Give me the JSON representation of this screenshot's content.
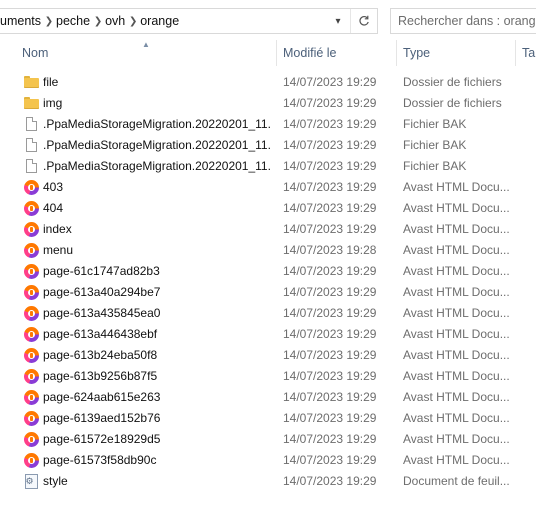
{
  "breadcrumb": [
    "uments",
    "peche",
    "ovh",
    "orange"
  ],
  "search": {
    "placeholder": "Rechercher dans : orange"
  },
  "columns": {
    "name": "Nom",
    "modified": "Modifié le",
    "type": "Type",
    "size": "Ta"
  },
  "icons": {
    "folder": "folder-icon",
    "file": "file-icon",
    "avast": "avast-html-icon",
    "stylesheet": "stylesheet-icon",
    "chevron": "chevron-right-icon",
    "refresh": "refresh-icon"
  },
  "colors": {
    "header_text": "#4c607a",
    "meta_text": "#6d6d6d",
    "folder": "#f4c44e"
  },
  "files": [
    {
      "name": "file",
      "date": "14/07/2023 19:29",
      "type": "Dossier de fichiers",
      "icon": "folder"
    },
    {
      "name": "img",
      "date": "14/07/2023 19:29",
      "type": "Dossier de fichiers",
      "icon": "folder"
    },
    {
      "name": ".PpaMediaStorageMigration.20220201_11...",
      "date": "14/07/2023 19:29",
      "type": "Fichier BAK",
      "icon": "file"
    },
    {
      "name": ".PpaMediaStorageMigration.20220201_11...",
      "date": "14/07/2023 19:29",
      "type": "Fichier BAK",
      "icon": "file"
    },
    {
      "name": ".PpaMediaStorageMigration.20220201_11...",
      "date": "14/07/2023 19:29",
      "type": "Fichier BAK",
      "icon": "file"
    },
    {
      "name": "403",
      "date": "14/07/2023 19:29",
      "type": "Avast HTML Docu...",
      "icon": "avast"
    },
    {
      "name": "404",
      "date": "14/07/2023 19:29",
      "type": "Avast HTML Docu...",
      "icon": "avast"
    },
    {
      "name": "index",
      "date": "14/07/2023 19:29",
      "type": "Avast HTML Docu...",
      "icon": "avast"
    },
    {
      "name": "menu",
      "date": "14/07/2023 19:28",
      "type": "Avast HTML Docu...",
      "icon": "avast"
    },
    {
      "name": "page-61c1747ad82b3",
      "date": "14/07/2023 19:29",
      "type": "Avast HTML Docu...",
      "icon": "avast"
    },
    {
      "name": "page-613a40a294be7",
      "date": "14/07/2023 19:29",
      "type": "Avast HTML Docu...",
      "icon": "avast"
    },
    {
      "name": "page-613a435845ea0",
      "date": "14/07/2023 19:29",
      "type": "Avast HTML Docu...",
      "icon": "avast"
    },
    {
      "name": "page-613a446438ebf",
      "date": "14/07/2023 19:29",
      "type": "Avast HTML Docu...",
      "icon": "avast"
    },
    {
      "name": "page-613b24eba50f8",
      "date": "14/07/2023 19:29",
      "type": "Avast HTML Docu...",
      "icon": "avast"
    },
    {
      "name": "page-613b9256b87f5",
      "date": "14/07/2023 19:29",
      "type": "Avast HTML Docu...",
      "icon": "avast"
    },
    {
      "name": "page-624aab615e263",
      "date": "14/07/2023 19:29",
      "type": "Avast HTML Docu...",
      "icon": "avast"
    },
    {
      "name": "page-6139aed152b76",
      "date": "14/07/2023 19:29",
      "type": "Avast HTML Docu...",
      "icon": "avast"
    },
    {
      "name": "page-61572e18929d5",
      "date": "14/07/2023 19:29",
      "type": "Avast HTML Docu...",
      "icon": "avast"
    },
    {
      "name": "page-61573f58db90c",
      "date": "14/07/2023 19:29",
      "type": "Avast HTML Docu...",
      "icon": "avast"
    },
    {
      "name": "style",
      "date": "14/07/2023 19:29",
      "type": "Document de feuil...",
      "icon": "stylesheet"
    }
  ]
}
